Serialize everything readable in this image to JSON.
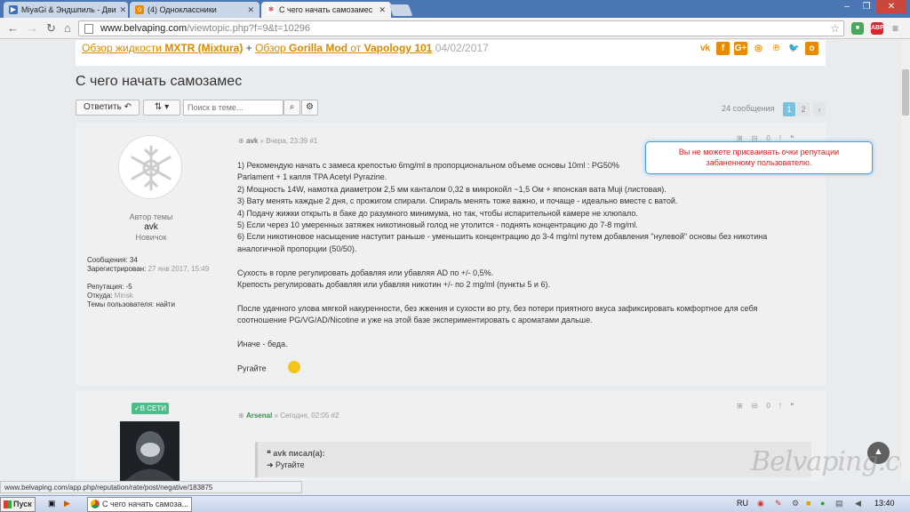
{
  "browser": {
    "tabs": [
      {
        "label": "MiyaGi & Эндшпиль - Дви",
        "icon": "youtube-icon"
      },
      {
        "label": "(4) Одноклассники",
        "icon": "odnoklassniki-icon"
      },
      {
        "label": "С чего начать самозамес",
        "icon": "belvaping-icon"
      }
    ],
    "url_host": "www.belvaping.com",
    "url_path": "/viewtopic.php?f=9&t=10296",
    "ext_abp": "ABP"
  },
  "breadcrumb": {
    "part1": "Обзор жидкости",
    "brand1": "MXTR (Mixtura)",
    "plus": "+",
    "part2": "Обзор",
    "brand2": "Gorilla Mod",
    "from": "от",
    "brand3": "Vapology 101",
    "date": "04/02/2017"
  },
  "topic_title": "С чего начать самозамес",
  "controls": {
    "reply_label": "Ответить",
    "search_placeholder": "Поиск в теме...",
    "count_label": "24 сообщения",
    "pages": [
      "1",
      "2"
    ]
  },
  "tooltip": {
    "line1": "Вы не можете присваивать очки репутации",
    "line2": "забаненному пользователю."
  },
  "post1": {
    "author_role": "Автор темы",
    "username": "avk",
    "rank": "Новичок",
    "head_author": "avk",
    "head_meta": "» Вчера, 23:39 #1",
    "counter": "0",
    "stats": [
      {
        "label": "Сообщения:",
        "value": "34"
      },
      {
        "label": "Зарегистрирован:",
        "value": "27 янв 2017, 15:49"
      },
      {
        "label": "Репутация:",
        "value": "-5"
      },
      {
        "label": "Откуда:",
        "value": "Minsk"
      },
      {
        "label": "Темы пользователя:",
        "value": "найти"
      }
    ],
    "lines": [
      "1) Рекомендую начать с замеса крепостью 6mg/ml в пропорциональном объеме основы 10ml : PG50%",
      "Parlament + 1 капля TPA Acetyl Pyrazine.",
      "2) Мощность 14W, намотка диаметром 2,5 мм канталом 0,32 в микрокойл ~1,5 Ом + японская вата Muji (листовая).",
      "3) Вату менять каждые 2 дня, с прожигом спирали. Спираль менять тоже важно, и почаще - идеально вместе с ватой.",
      "4) Подачу жижки открыть в баке до разумного минимума, но так, чтобы испарительной камере не хлюпало.",
      "5) Если через 10 умеренных затяжек никотиновый голод не утолится - поднять концентрацию до 7-8 mg/ml.",
      "6) Если никотиновое насыщение наступит раньше - уменьшить концентрацию до 3-4 mg/ml путем добавления \"нулевой\" основы без никотина",
      "аналогичной пропорции (50/50).",
      "",
      "Сухость в горле регулировать добавляя или убавляя AD по +/- 0,5%.",
      "Крепость регулировать добавляя или убавляя никотин +/- по 2 mg/ml (пункты 5 и 6).",
      "",
      "После удачного улова мягкой накуренности, без жжения и сухости во рту, без потери приятного вкуса зафиксировать комфортное для себя",
      "соотношение PG/VG/AD/Nicotine и уже на этой базе экспериментировать с ароматами дальше.",
      "",
      "Иначе - беда.",
      "",
      "Ругайте"
    ]
  },
  "post2": {
    "online_badge": "В СЕТИ",
    "head_author": "Arsenal",
    "head_meta": "» Сегодня, 02:05 #2",
    "counter": "0",
    "quote_title": "avk писал(а):",
    "quote_text": "➜ Ругайте"
  },
  "watermark": "Belvaping.com",
  "status_url": "www.belvaping.com/app.php/reputation/rate/post/negative/183875",
  "taskbar": {
    "start": "Пуск",
    "task": "С чего начать самоза...",
    "lang": "RU",
    "clock": "13:40"
  },
  "colors": {
    "accent": "#e88b00",
    "link": "#d88a00",
    "online": "#4cbd8a",
    "warning_text": "#dd2222"
  }
}
